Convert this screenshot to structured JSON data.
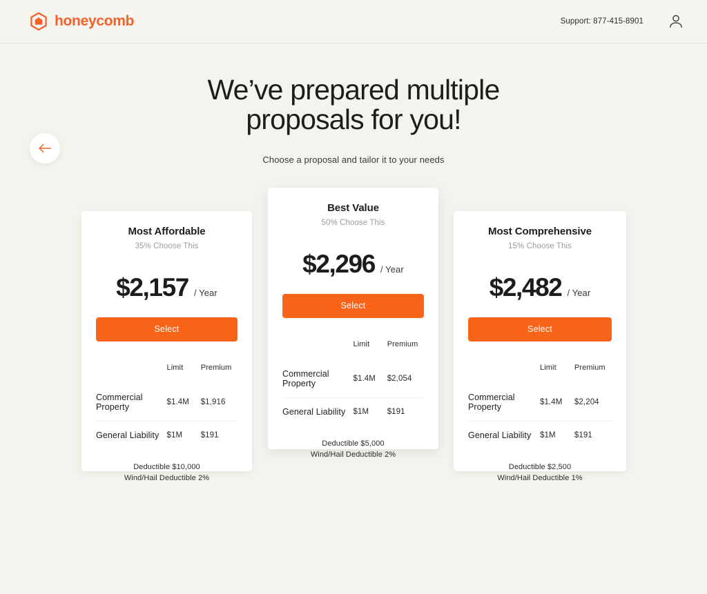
{
  "header": {
    "brand_name": "honeycomb",
    "brand_color": "#f2622a",
    "support_label": "Support: 877-415-8901",
    "logo_icon": "honeycomb-hexagon-house-logo",
    "account_icon": "person-account-icon"
  },
  "hero": {
    "back_icon": "arrow-left-icon",
    "title": "We’ve prepared multiple proposals for you!",
    "subtitle": "Choose a proposal and tailor it to your needs"
  },
  "table_headers": {
    "coverage": "",
    "limit": "Limit",
    "premium": "Premium"
  },
  "accent_color": "#fa6418",
  "background_color": "#f4f3ed",
  "proposals": [
    {
      "id": "most-affordable",
      "title": "Most Affordable",
      "subtitle": "35% Choose This",
      "price": "$2,157",
      "period": "/ Year",
      "select_label": "Select",
      "rows": [
        {
          "name": "Commercial Property",
          "limit": "$1.4M",
          "premium": "$1,916"
        },
        {
          "name": "General Liability",
          "limit": "$1M",
          "premium": "$191"
        }
      ],
      "deductible": "Deductible $10,000",
      "wind_hail": "Wind/Hail Deductible 2%"
    },
    {
      "id": "best-value",
      "title": "Best Value",
      "subtitle": "50% Choose This",
      "price": "$2,296",
      "period": "/ Year",
      "select_label": "Select",
      "rows": [
        {
          "name": "Commercial Property",
          "limit": "$1.4M",
          "premium": "$2,054"
        },
        {
          "name": "General Liability",
          "limit": "$1M",
          "premium": "$191"
        }
      ],
      "deductible": "Deductible $5,000",
      "wind_hail": "Wind/Hail Deductible 2%"
    },
    {
      "id": "most-comprehensive",
      "title": "Most Comprehensive",
      "subtitle": "15% Choose This",
      "price": "$2,482",
      "period": "/ Year",
      "select_label": "Select",
      "rows": [
        {
          "name": "Commercial Property",
          "limit": "$1.4M",
          "premium": "$2,204"
        },
        {
          "name": "General Liability",
          "limit": "$1M",
          "premium": "$191"
        }
      ],
      "deductible": "Deductible $2,500",
      "wind_hail": "Wind/Hail Deductible 1%"
    }
  ]
}
